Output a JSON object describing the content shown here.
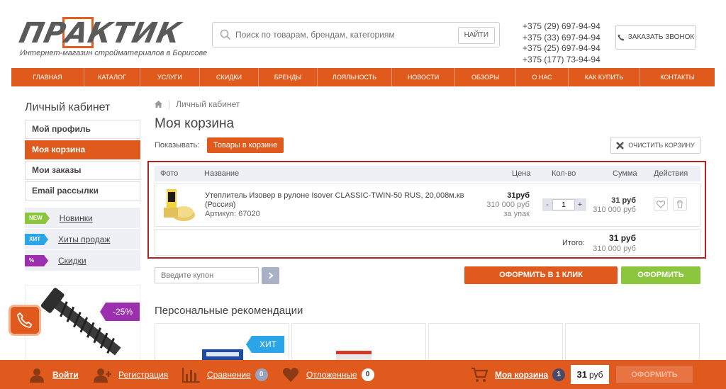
{
  "header": {
    "logo_text": "ПРАКТИК",
    "logo_subtitle": "Интернет-магазин стройматериалов в Борисове",
    "search_placeholder": "Поиск по товарам, брендам, категориям",
    "search_button": "НАЙТИ",
    "phones": [
      "+375 (29) 697-94-94",
      "+375 (33) 697-94-94",
      "+375 (25) 697-94-94",
      "+375 (177) 73-94-94"
    ],
    "callback_label": "ЗАКАЗАТЬ ЗВОНОК"
  },
  "nav": {
    "items": [
      "ГЛАВНАЯ",
      "КАТАЛОГ",
      "УСЛУГИ",
      "СКИДКИ",
      "БРЕНДЫ",
      "ЛОЯЛЬНОСТЬ",
      "НОВОСТИ",
      "ОБЗОРЫ",
      "О НАС",
      "КАК КУПИТЬ",
      "КОНТАКТЫ"
    ]
  },
  "sidebar": {
    "title": "Личный кабинет",
    "items": [
      "Мой профиль",
      "Моя корзина",
      "Мои заказы",
      "Email рассылки"
    ],
    "active_index": 1,
    "promos": [
      {
        "tag": "NEW",
        "label": "Новинки",
        "color": "#8cc63e"
      },
      {
        "tag": "ХИТ",
        "label": "Хиты продаж",
        "color": "#2aa6e8"
      },
      {
        "tag": "%",
        "label": "Скидки",
        "color": "#9b2fae"
      }
    ],
    "banner_discount": "-25%"
  },
  "main": {
    "breadcrumb": "Личный кабинет",
    "title": "Моя корзина",
    "show_label": "Показывать:",
    "show_value": "Товары в корзине",
    "clear_label": "ОЧИСТИТЬ КОРЗИНУ",
    "table_headers": {
      "photo": "Фото",
      "name": "Название",
      "price": "Цена",
      "qty": "Кол-во",
      "sum": "Сумма",
      "actions": "Действия"
    },
    "item": {
      "name": "Утеплитель Изовер в рулоне Isover CLASSIC-TWIN-50 RUS, 20,008м.кв (Россия)",
      "article": "Артикул: 67020",
      "price": "31руб",
      "price_old": "310 000 руб",
      "price_unit": "за упак",
      "qty": "1",
      "qty_minus": "-",
      "qty_plus": "+",
      "sum": "31 руб",
      "sum_old": "310 000 руб"
    },
    "total_label": "Итого:",
    "total": "31 руб",
    "total_old": "310 000 руб",
    "coupon_placeholder": "Введите купон",
    "one_click_label": "ОФОРМИТЬ В 1 КЛИК",
    "checkout_label": "ОФОРМИТЬ",
    "recommendations_title": "Персональные рекомендации",
    "rec_badge": "ХИТ"
  },
  "bottom_bar": {
    "login": "Войти",
    "register": "Регистрация",
    "compare": "Сравнение",
    "compare_count": "0",
    "deferred": "Отложенные",
    "deferred_count": "0",
    "cart": "Моя корзина",
    "cart_count": "1",
    "cart_sum_value": "31",
    "cart_sum_unit": "руб",
    "checkout": "ОФОРМИТЬ"
  },
  "colors": {
    "accent": "#e0591d",
    "green": "#8cc63e",
    "blue": "#2aa6e8",
    "purple": "#9b2fae",
    "highlight_border": "#b22222"
  }
}
